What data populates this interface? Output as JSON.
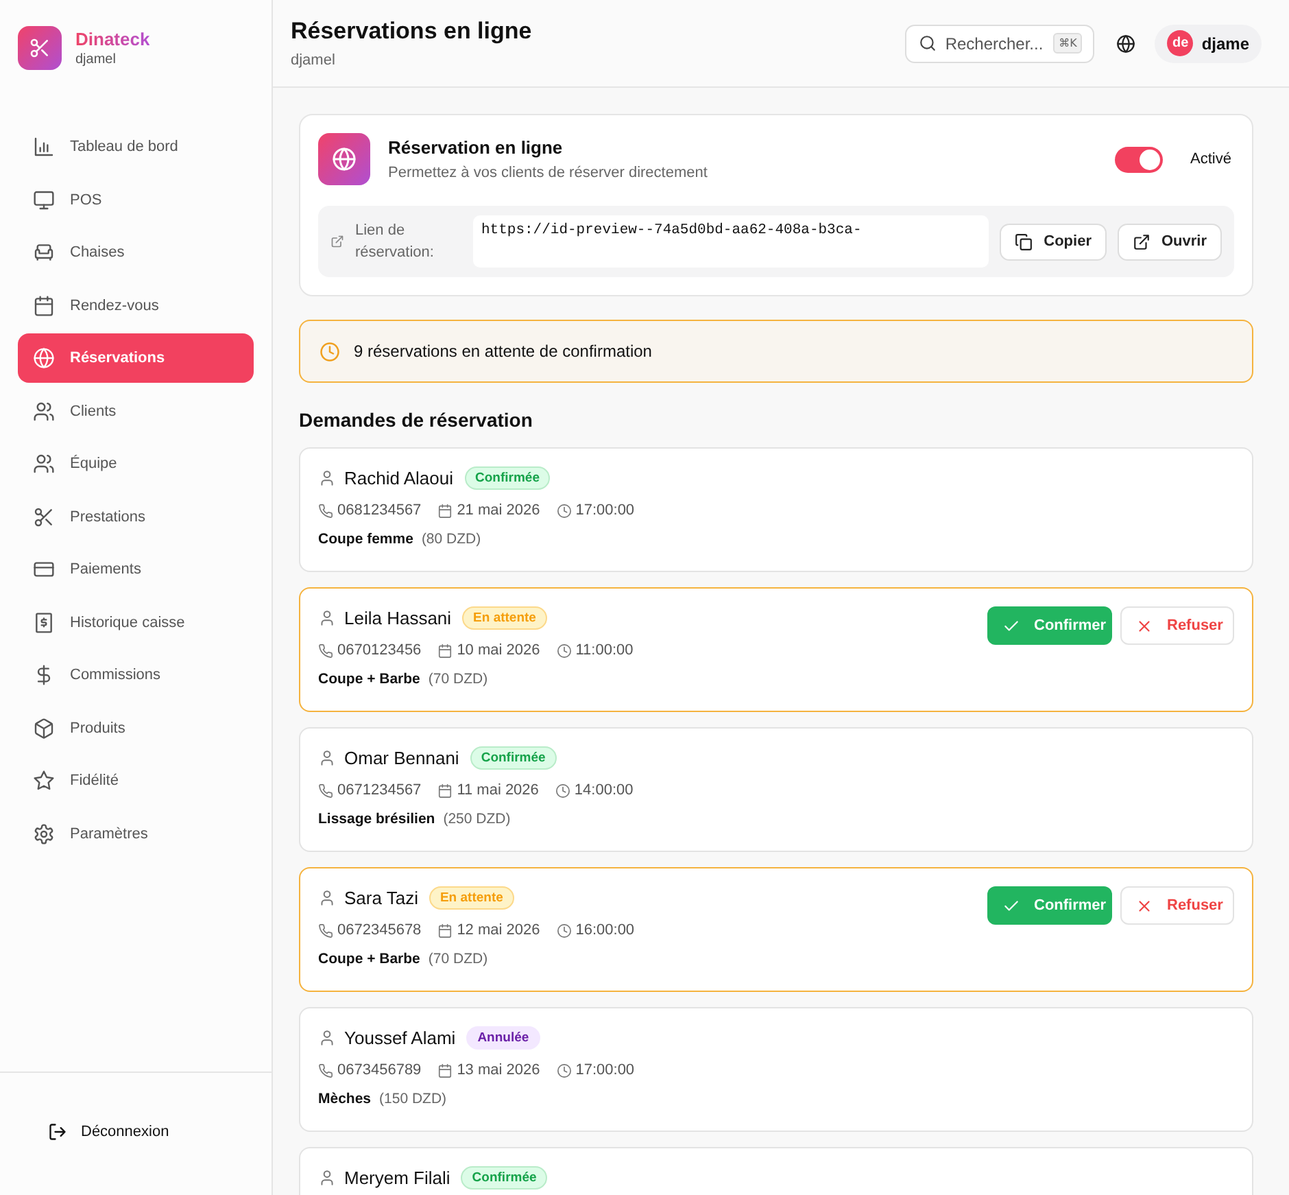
{
  "brand": {
    "name": "Dinateck",
    "user": "djamel"
  },
  "sidebar": {
    "items": [
      {
        "label": "Tableau de bord",
        "selected": false
      },
      {
        "label": "POS",
        "selected": false
      },
      {
        "label": "Chaises",
        "selected": false
      },
      {
        "label": "Rendez-vous",
        "selected": false
      },
      {
        "label": "Réservations",
        "selected": true
      },
      {
        "label": "Clients",
        "selected": false
      },
      {
        "label": "Équipe",
        "selected": false
      },
      {
        "label": "Prestations",
        "selected": false
      },
      {
        "label": "Paiements",
        "selected": false
      },
      {
        "label": "Historique caisse",
        "selected": false
      },
      {
        "label": "Commissions",
        "selected": false
      },
      {
        "label": "Produits",
        "selected": false
      },
      {
        "label": "Fidélité",
        "selected": false
      },
      {
        "label": "Paramètres",
        "selected": false
      }
    ],
    "logout": "Déconnexion"
  },
  "header": {
    "title": "Réservations en ligne",
    "subtitle": "djamel",
    "search": {
      "placeholder": "Rechercher...",
      "shortcut": "⌘K"
    },
    "user": {
      "initials": "de",
      "name": "djame"
    }
  },
  "online_booking": {
    "title": "Réservation en ligne",
    "description": "Permettez à vos clients de réserver directement",
    "toggle": {
      "on": true,
      "label": "Activé"
    },
    "link_label": "Lien de réservation:",
    "link": "https://id-preview--74a5d0bd-aa62-408a-b3ca-",
    "buttons": [
      "Copier",
      "Ouvrir"
    ]
  },
  "pending_alert": "9 réservations en attente de confirmation",
  "requests": {
    "title": "Demandes de réservation",
    "items": [
      {
        "name": "Rachid Alaoui",
        "status": {
          "kind": "confirmed",
          "label": "Confirmée"
        },
        "phone": "0681234567",
        "date": "21 mai 2026",
        "time": "17:00:00",
        "service": "Coupe femme",
        "price": "(80 DZD)"
      },
      {
        "name": "Leila Hassani",
        "status": {
          "kind": "pending",
          "label": "En attente"
        },
        "phone": "0670123456",
        "date": "10 mai 2026",
        "time": "11:00:00",
        "service": "Coupe + Barbe",
        "price": "(70 DZD)",
        "actions": [
          "Confirmer",
          "Refuser"
        ]
      },
      {
        "name": "Omar Bennani",
        "status": {
          "kind": "confirmed",
          "label": "Confirmée"
        },
        "phone": "0671234567",
        "date": "11 mai 2026",
        "time": "14:00:00",
        "service": "Lissage brésilien",
        "price": "(250 DZD)"
      },
      {
        "name": "Sara Tazi",
        "status": {
          "kind": "pending",
          "label": "En attente"
        },
        "phone": "0672345678",
        "date": "12 mai 2026",
        "time": "16:00:00",
        "service": "Coupe + Barbe",
        "price": "(70 DZD)",
        "actions": [
          "Confirmer",
          "Refuser"
        ]
      },
      {
        "name": "Youssef Alami",
        "status": {
          "kind": "cancelled",
          "label": "Annulée"
        },
        "phone": "0673456789",
        "date": "13 mai 2026",
        "time": "17:00:00",
        "service": "Mèches",
        "price": "(150 DZD)"
      },
      {
        "name": "Meryem Filali",
        "status": {
          "kind": "confirmed",
          "label": "Confirmée"
        }
      }
    ]
  }
}
